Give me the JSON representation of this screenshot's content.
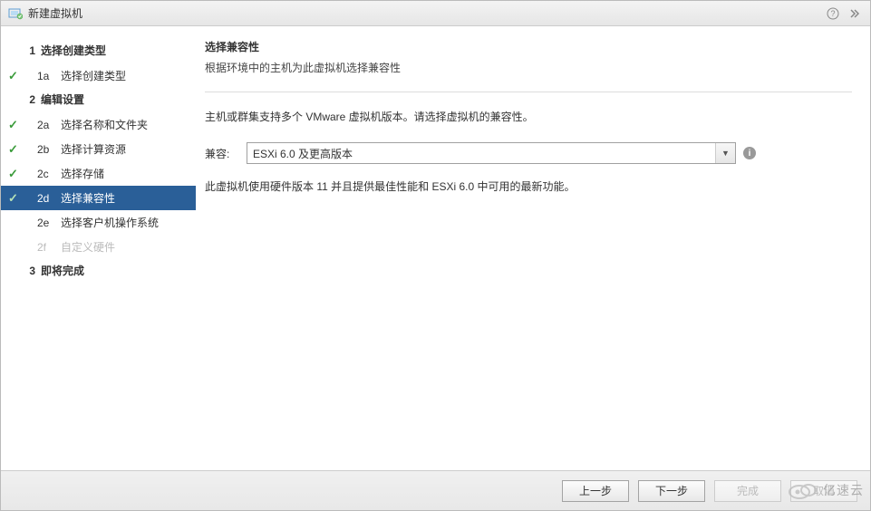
{
  "titlebar": {
    "title": "新建虚拟机"
  },
  "sidebar": {
    "sections": [
      {
        "num": "1",
        "label": "选择创建类型"
      },
      {
        "num": "2",
        "label": "编辑设置"
      },
      {
        "num": "3",
        "label": "即将完成"
      }
    ],
    "steps": [
      {
        "id": "1a",
        "label": "选择创建类型",
        "checked": true,
        "active": false
      },
      {
        "id": "2a",
        "label": "选择名称和文件夹",
        "checked": true,
        "active": false
      },
      {
        "id": "2b",
        "label": "选择计算资源",
        "checked": true,
        "active": false
      },
      {
        "id": "2c",
        "label": "选择存储",
        "checked": true,
        "active": false
      },
      {
        "id": "2d",
        "label": "选择兼容性",
        "checked": true,
        "active": true
      },
      {
        "id": "2e",
        "label": "选择客户机操作系统",
        "checked": false,
        "active": false
      },
      {
        "id": "2f",
        "label": "自定义硬件",
        "checked": false,
        "active": false,
        "disabled": true
      }
    ]
  },
  "main": {
    "title": "选择兼容性",
    "subtitle": "根据环境中的主机为此虚拟机选择兼容性",
    "desc": "主机或群集支持多个 VMware 虚拟机版本。请选择虚拟机的兼容性。",
    "compat_label": "兼容:",
    "compat_value": "ESXi 6.0 及更高版本",
    "hint": "此虚拟机使用硬件版本 11 并且提供最佳性能和 ESXi 6.0 中可用的最新功能。"
  },
  "footer": {
    "back": "上一步",
    "next": "下一步",
    "finish": "完成",
    "cancel": "取消"
  },
  "watermark": {
    "text": "亿速云"
  }
}
